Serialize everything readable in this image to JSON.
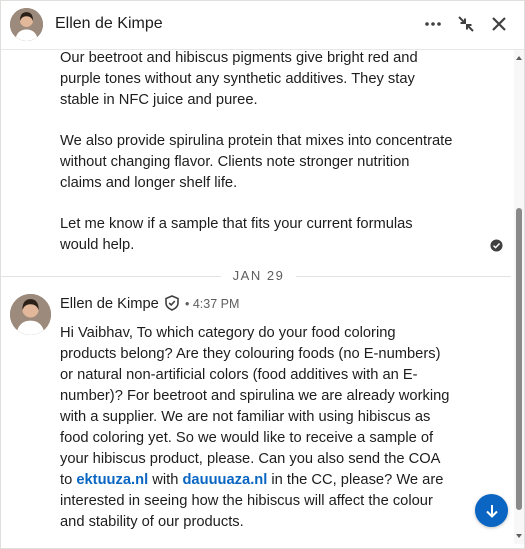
{
  "header": {
    "name": "Ellen de Kimpe",
    "more_icon": "more-horizontal-icon",
    "minimize_icon": "collapse-arrows-icon",
    "close_icon": "close-icon"
  },
  "previous_message": {
    "paragraphs": [
      "Our beetroot and hibiscus pigments give bright red and purple tones without any synthetic additives. They stay stable in NFC juice and puree.",
      "We also provide spirulina protein that mixes into concentrate without changing flavor. Clients note stronger nutrition claims and longer shelf life.",
      "Let me know if a sample that fits your current formulas would help."
    ],
    "status_icon": "seen-check-icon"
  },
  "date_divider": "JAN 29",
  "message": {
    "sender": "Ellen de Kimpe",
    "verified_icon": "verified-shield-icon",
    "time": "• 4:37 PM",
    "body_part1": "Hi Vaibhav, To which category do your food coloring products belong? Are they colouring foods (no E-numbers) or natural non-artificial colors (food additives with an E-number)? For beetroot and spirulina we are already working with a supplier. We are not familiar with using hibiscus as food coloring yet. So we would like to receive a sample of your hibiscus product, please. Can you also send the COA to ",
    "link1": "ektuuza.nl",
    "body_part2": " with ",
    "link2": "dauuuaza.nl",
    "body_part3": " in the CC, please? We are interested in seeing how the hibiscus will affect the colour and stability of our products."
  },
  "colors": {
    "accent": "#0a66c2",
    "text": "#1d1d1d",
    "muted": "#5e5e5e"
  },
  "jump_button_icon": "arrow-down-icon"
}
